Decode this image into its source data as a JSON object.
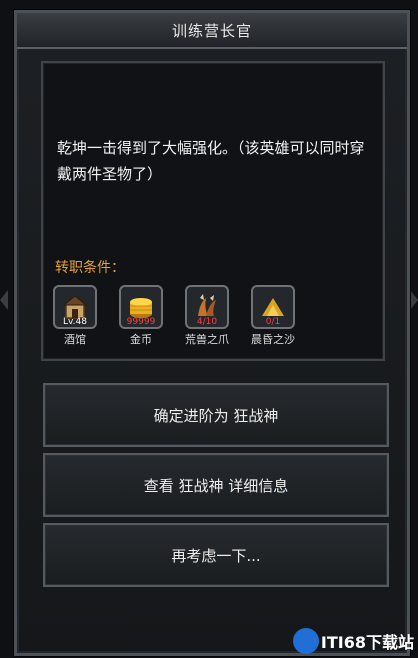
{
  "dialog": {
    "title": "训练营长官",
    "description": "乾坤一击得到了大幅强化。（该英雄可以同时穿戴两件圣物了）",
    "condition_label": "转职条件：",
    "requirements": [
      {
        "icon": "tavern-icon",
        "badge": "Lv.48",
        "label": "酒馆",
        "badge_color": "#ffffff"
      },
      {
        "icon": "gold-coins-icon",
        "badge": "99999",
        "label": "金币",
        "badge_color": "#ff4040"
      },
      {
        "icon": "beast-claw-icon",
        "badge": "4/10",
        "label": "荒兽之爪",
        "badge_color": "#ff4040"
      },
      {
        "icon": "dusk-sand-icon",
        "badge": "0/1",
        "label": "晨昏之沙",
        "badge_color": "#ff4040"
      }
    ]
  },
  "actions": {
    "confirm": "确定进阶为 狂战神",
    "details": "查看 狂战神 详细信息",
    "reconsider": "再考虑一下..."
  },
  "watermark": {
    "text": "ITI68下载站"
  },
  "colors": {
    "accent": "#e2a036",
    "warning": "#ff4040"
  }
}
